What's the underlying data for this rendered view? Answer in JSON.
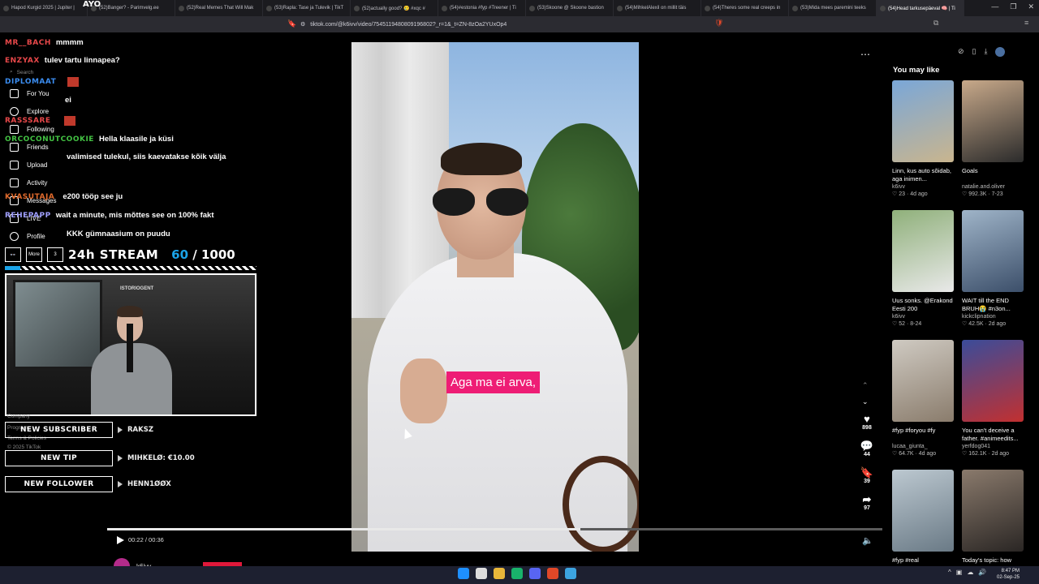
{
  "browser": {
    "tabs": [
      {
        "title": "Hapod Kurgid 2025 | Jupiter |"
      },
      {
        "title": "(52)Banger? - Parimvelg.ee"
      },
      {
        "title": "(52)Real Memes That Will Mak"
      },
      {
        "title": "(53)Rapla: Tase ja Tulevik | TikT"
      },
      {
        "title": "(52)actually good? 🥲 #xqc #"
      },
      {
        "title": "(54)#estonia #fyp #Treener | Ti"
      },
      {
        "title": "(53)Skoone @ Skoone bastion"
      },
      {
        "title": "(54)MihkelAlexil on millit täis"
      },
      {
        "title": "(54)Theres some real creeps in"
      },
      {
        "title": "(53)Mida mees paremini teeks"
      },
      {
        "title": "(54)Head tarkusepäeval 🧠 | Ti",
        "active": true
      }
    ],
    "url": "tiktok.com/@k6ivv/video/7545119480809196802?_r=1&_t=ZN-8zOa2YUxOp4",
    "window_controls": [
      "—",
      "❐",
      "✕"
    ]
  },
  "chat": {
    "lines": [
      {
        "user": "MR__BACH",
        "message": "mmmm",
        "color": "#e8484a"
      },
      {
        "user": "ENZYAX",
        "message": "tulev tartu linnapea?",
        "color": "#e8484a"
      },
      {
        "user": "DIPLOMAAT",
        "message": "",
        "color": "#3b8df0"
      },
      {
        "user": "",
        "message": "ei",
        "color": "#3b8df0"
      },
      {
        "user": "RASSSARE",
        "message": "",
        "color": "#e8484a"
      },
      {
        "user": "ORCOCONUTCOOKIE",
        "message": "Hella klaasile ja küsi",
        "color": "#43c143"
      },
      {
        "user": "",
        "message": "valimised tulekul, siis kaevatakse kõik välja",
        "color": "#b050e0"
      },
      {
        "user": "KVASUTAJA",
        "message": "e200 tööp see ju",
        "color": "#e06a2c"
      },
      {
        "user": "REHEPAPP",
        "message": "wait a minute, mis mõttes see on 100% fakt",
        "color": "#a0a0ff"
      },
      {
        "user": "",
        "message": "KKK gümnaasium on puudu",
        "color": "#b050e0"
      }
    ],
    "top_badge": "AYO"
  },
  "tiktok_sidebar": {
    "search_placeholder": "Search",
    "items": [
      "For You",
      "Explore",
      "Following",
      "Friends",
      "Upload",
      "Activity",
      "Messages",
      "LIVE",
      "Profile",
      "More"
    ],
    "footer": [
      "Company",
      "Program",
      "Terms & Policies",
      "© 2025 TikTok"
    ]
  },
  "goal": {
    "title": "24h STREAM",
    "current": "60",
    "separator": "/",
    "target": "1000",
    "progress": 0.06,
    "boxes": [
      "👓",
      "↑",
      "3"
    ]
  },
  "webcam": {
    "sign": "ISTORIOGENT"
  },
  "alerts": [
    {
      "label": "NEW SUBSCRIBER",
      "value": "RAKSZ"
    },
    {
      "label": "NEW TIP",
      "value": "MIHKELØ: €10.00"
    },
    {
      "label": "NEW FOLLOWER",
      "value": "HENN1ØØX"
    }
  ],
  "video": {
    "caption": "Aga ma ei arva,",
    "time": "00:22 / 00:36",
    "progress": 0.61,
    "author": "k6ivv",
    "actions": [
      {
        "icon": "♥",
        "count": "898"
      },
      {
        "icon": "💬",
        "count": "44"
      },
      {
        "icon": "🔖",
        "count": "39"
      },
      {
        "icon": "➦",
        "count": "97"
      }
    ]
  },
  "recommendations": {
    "title": "You may like",
    "cards": [
      {
        "title": "Linn, kus auto sõidab, aga inimen...",
        "user": "k6ivv",
        "meta": "♡ 23 · 4d ago",
        "colors": [
          "#7aa7d8",
          "#c9b58e"
        ]
      },
      {
        "title": "Goals",
        "user": "natalie.and.oliver",
        "meta": "♡ 992.3K · 7-23",
        "colors": [
          "#c8a98a",
          "#2b2b2b"
        ]
      },
      {
        "title": "Uus sonks. @Erakond Eesti 200",
        "user": "k6ivv",
        "meta": "♡ 52 · 8-24",
        "colors": [
          "#8fb07a",
          "#e9e9e9"
        ]
      },
      {
        "title": "WAIT till the END BRUH😭 #n3on...",
        "user": "kickclipnation",
        "meta": "♡ 42.5K · 2d ago",
        "colors": [
          "#9fb4c8",
          "#3c4f6a"
        ]
      },
      {
        "title": "#fyp #foryou #fy",
        "user": "lucaa_giunta_",
        "meta": "♡ 64.7K · 4d ago",
        "colors": [
          "#cfcac2",
          "#8a7c6c"
        ]
      },
      {
        "title": "You can't deceive a father. #animeedits...",
        "user": "yerfdog041",
        "meta": "♡ 162.1K · 2d ago",
        "colors": [
          "#3a4c9a",
          "#c23030"
        ]
      },
      {
        "title": "#fyp #real",
        "user": "",
        "meta": "",
        "colors": [
          "#bcc8d0",
          "#6a7a86"
        ]
      },
      {
        "title": "Today's topic: how",
        "user": "",
        "meta": "",
        "colors": [
          "#8a7a6c",
          "#2a2624"
        ]
      }
    ]
  },
  "taskbar": {
    "apps": [
      "#1e90ff",
      "#dddddd",
      "#e8b73a",
      "#19b36b",
      "#5865f2",
      "#e04828",
      "#3ca4e0"
    ],
    "tray": [
      "^",
      "▣",
      "☁",
      "🔊"
    ],
    "time": "8:47 PM",
    "date": "02-Sep-25"
  }
}
